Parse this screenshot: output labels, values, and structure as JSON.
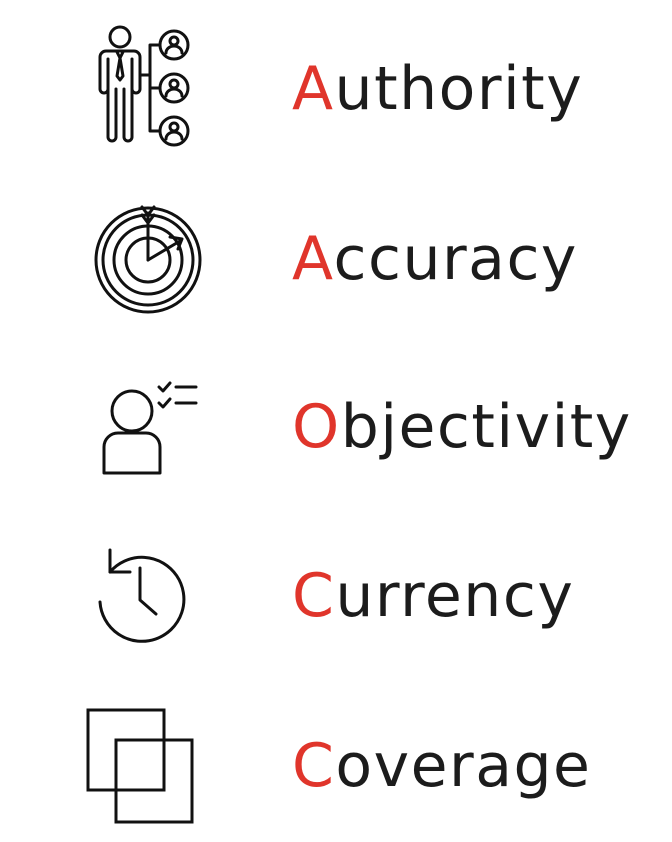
{
  "accent_color": "#e0352b",
  "text_color": "#1c1c1c",
  "items": [
    {
      "first_letter": "A",
      "rest": "uthority",
      "icon": "authority-org-chart-icon"
    },
    {
      "first_letter": "A",
      "rest": "ccuracy",
      "icon": "target-dart-icon"
    },
    {
      "first_letter": "O",
      "rest": "bjectivity",
      "icon": "person-checklist-icon"
    },
    {
      "first_letter": "C",
      "rest": "urrency",
      "icon": "history-clock-icon"
    },
    {
      "first_letter": "C",
      "rest": "overage",
      "icon": "overlapping-squares-icon"
    }
  ]
}
